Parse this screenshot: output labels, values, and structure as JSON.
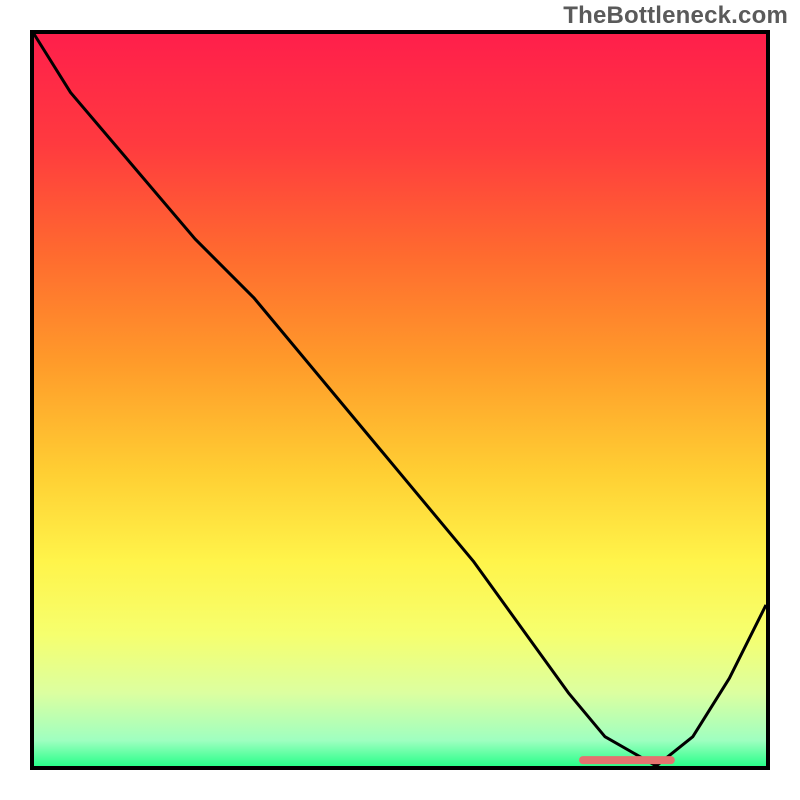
{
  "watermark": "TheBottleneck.com",
  "chart_data": {
    "type": "line",
    "title": "",
    "xlabel": "",
    "ylabel": "",
    "xlim": [
      0,
      100
    ],
    "ylim": [
      0,
      100
    ],
    "x": [
      0,
      5,
      22,
      30,
      40,
      50,
      60,
      73,
      78,
      85,
      90,
      95,
      100
    ],
    "values": [
      100,
      92,
      72,
      64,
      52,
      40,
      28,
      10,
      4,
      0,
      4,
      12,
      22
    ],
    "marker_segment": {
      "x1": 75,
      "x2": 87,
      "y": 0.8
    },
    "gradient_stops": [
      {
        "offset": 0.0,
        "color": "#ff1f4b"
      },
      {
        "offset": 0.15,
        "color": "#ff3a3f"
      },
      {
        "offset": 0.3,
        "color": "#ff6a2f"
      },
      {
        "offset": 0.45,
        "color": "#ff9b2a"
      },
      {
        "offset": 0.6,
        "color": "#ffcf33"
      },
      {
        "offset": 0.72,
        "color": "#fff44a"
      },
      {
        "offset": 0.82,
        "color": "#f6ff6e"
      },
      {
        "offset": 0.9,
        "color": "#dcffa0"
      },
      {
        "offset": 0.965,
        "color": "#9fffc0"
      },
      {
        "offset": 1.0,
        "color": "#2aff8a"
      }
    ],
    "line_color": "#000000",
    "marker_color": "#e4736f",
    "border_width": 4
  }
}
